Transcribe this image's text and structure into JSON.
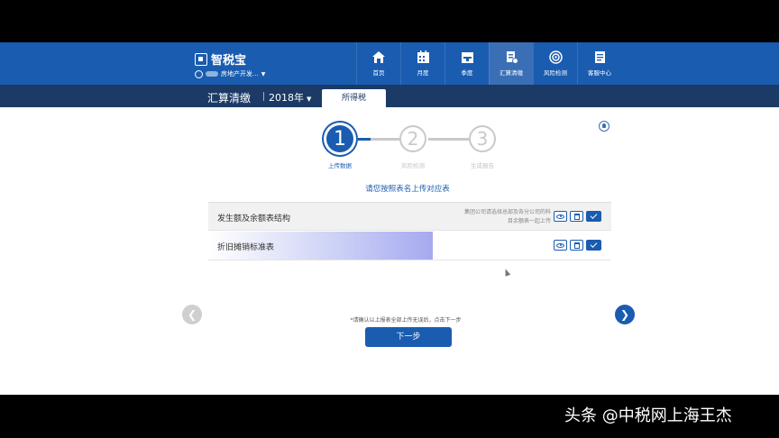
{
  "brand": {
    "name": "智税宝",
    "company": "房地产开发..."
  },
  "nav": {
    "tabs": [
      {
        "label": "首页",
        "icon": "home-icon"
      },
      {
        "label": "月度",
        "icon": "calendar-month-icon"
      },
      {
        "label": "季度",
        "icon": "calendar-quarter-icon"
      },
      {
        "label": "汇算清缴",
        "icon": "document-settle-icon",
        "active": true
      },
      {
        "label": "风险检测",
        "icon": "target-icon"
      },
      {
        "label": "客服中心",
        "icon": "service-doc-icon"
      }
    ]
  },
  "subbar": {
    "title": "汇算清缴",
    "year": "2018年",
    "tab": "所得税"
  },
  "stepper": {
    "steps": [
      {
        "num": "1",
        "label": "上传数据",
        "state": "active"
      },
      {
        "num": "2",
        "label": "风险检测",
        "state": "pending"
      },
      {
        "num": "3",
        "label": "生成报告",
        "state": "pending"
      }
    ]
  },
  "instruction": "请您按照表名上传对应表",
  "files": [
    {
      "name": "发生额及余额表结构",
      "hint": "集团公司请选择总部及各分公司的科目余额表一起上传",
      "progress": 0
    },
    {
      "name": "折旧摊销标准表",
      "hint": "",
      "progress": 0.557
    }
  ],
  "footer": {
    "note": "*请确认以上报表全部上传无误后，点击下一步",
    "next_label": "下一步"
  },
  "colors": {
    "primary": "#1a5cb0",
    "subbar": "#1c3a66",
    "active_tab": "#3a6fb6"
  },
  "watermark": "头条 @中税网上海王杰"
}
